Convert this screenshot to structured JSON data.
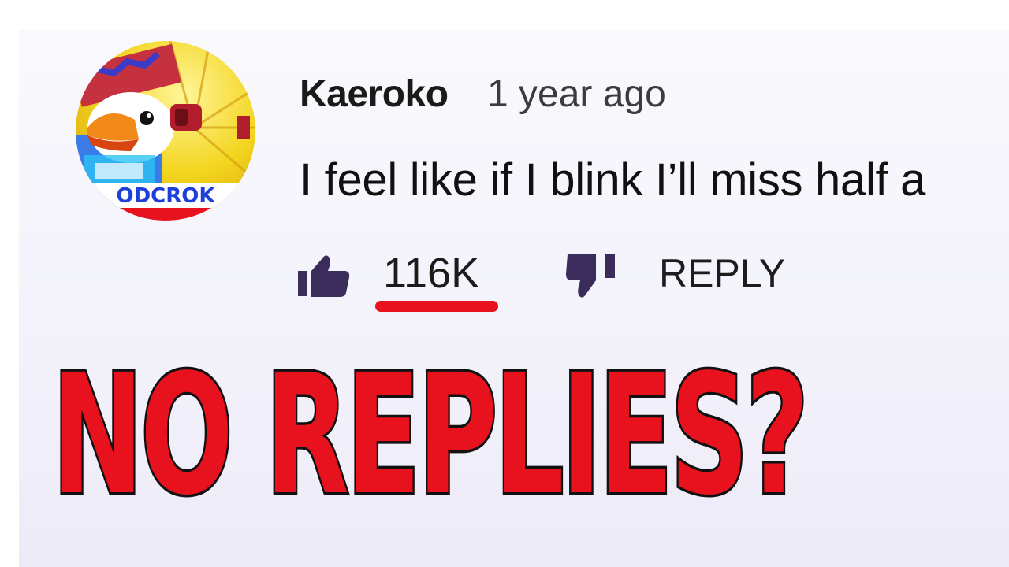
{
  "comment": {
    "author": "Kaeroko",
    "timestamp": "1 year ago",
    "text": "I feel like if I blink I’ll miss half a",
    "like_count": "116K",
    "reply_label": "REPLY",
    "avatar_text": "ODCROK"
  },
  "overlay": {
    "headline": "NO REPLIES?"
  },
  "colors": {
    "accent_red": "#e8121e",
    "icon_purple": "#3a2d5c",
    "background": "#f3f2fb"
  },
  "icons": {
    "like": "thumbs-up-icon",
    "dislike": "thumbs-down-icon"
  }
}
